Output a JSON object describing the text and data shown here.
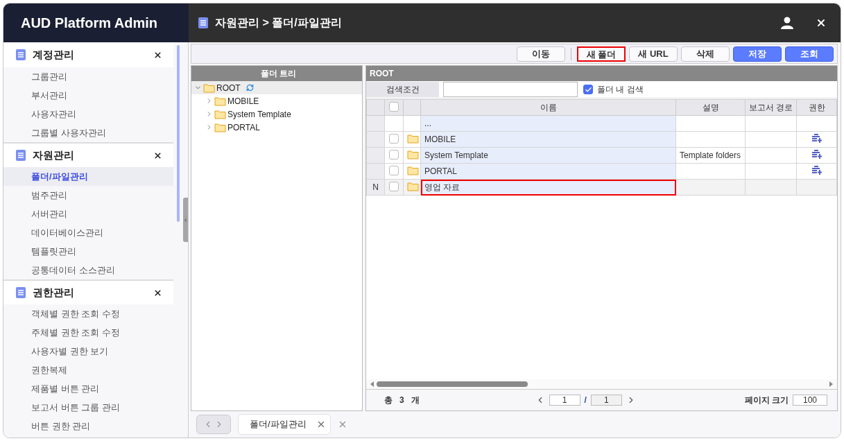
{
  "app_title": "AUD Platform Admin",
  "breadcrumb": "자원관리 > 폴더/파일관리",
  "sidebar": {
    "sections": [
      {
        "title": "계정관리",
        "items": [
          {
            "label": "그룹관리",
            "selected": false
          },
          {
            "label": "부서관리",
            "selected": false
          },
          {
            "label": "사용자관리",
            "selected": false
          },
          {
            "label": "그룹별 사용자관리",
            "selected": false
          }
        ]
      },
      {
        "title": "자원관리",
        "items": [
          {
            "label": "폴더/파일관리",
            "selected": true
          },
          {
            "label": "범주관리",
            "selected": false
          },
          {
            "label": "서버관리",
            "selected": false
          },
          {
            "label": "데이터베이스관리",
            "selected": false
          },
          {
            "label": "템플릿관리",
            "selected": false
          },
          {
            "label": "공통데이터 소스관리",
            "selected": false
          }
        ]
      },
      {
        "title": "권한관리",
        "items": [
          {
            "label": "객체별 권한 조회 수정",
            "selected": false
          },
          {
            "label": "주체별 권한 조회 수정",
            "selected": false
          },
          {
            "label": "사용자별 권한 보기",
            "selected": false
          },
          {
            "label": "권한복제",
            "selected": false
          },
          {
            "label": "제품별 버튼 관리",
            "selected": false
          },
          {
            "label": "보고서 버튼 그룹 관리",
            "selected": false
          },
          {
            "label": "버튼 권한 관리",
            "selected": false
          }
        ]
      }
    ]
  },
  "toolbar": {
    "buttons": [
      {
        "label": "이동",
        "kind": "default",
        "highlighted": false
      },
      {
        "label": "새 폴더",
        "kind": "default",
        "highlighted": true
      },
      {
        "label": "새 URL",
        "kind": "default",
        "highlighted": false
      },
      {
        "label": "삭제",
        "kind": "default",
        "highlighted": false
      },
      {
        "label": "저장",
        "kind": "primary",
        "highlighted": false
      },
      {
        "label": "조회",
        "kind": "primary",
        "highlighted": false
      }
    ]
  },
  "tree": {
    "title": "폴더 트리",
    "root": {
      "label": "ROOT",
      "expanded": true,
      "children": [
        {
          "label": "MOBILE",
          "expanded": false
        },
        {
          "label": "System Template",
          "expanded": false
        },
        {
          "label": "PORTAL",
          "expanded": false
        }
      ]
    }
  },
  "grid": {
    "title": "ROOT",
    "search_label": "검색조건",
    "in_folder_search": {
      "label": "폴더 내 검색",
      "checked": true
    },
    "select_all_checked": false,
    "columns": [
      "이름",
      "설명",
      "보고서 경로",
      "권한"
    ],
    "rows": [
      {
        "kind": "parent",
        "name": "..."
      },
      {
        "kind": "folder",
        "status": "",
        "checked": false,
        "name": "MOBILE",
        "description": "",
        "permission": true,
        "highlighted": false
      },
      {
        "kind": "folder",
        "status": "",
        "checked": false,
        "name": "System Template",
        "description": "Template folders",
        "permission": true,
        "highlighted": false
      },
      {
        "kind": "folder",
        "status": "",
        "checked": false,
        "name": "PORTAL",
        "description": "",
        "permission": true,
        "highlighted": false
      },
      {
        "kind": "folder",
        "status": "N",
        "checked": false,
        "name": "영업 자료",
        "description": "",
        "permission": false,
        "highlighted": true
      }
    ],
    "footer": {
      "total_label": "총",
      "total": "3",
      "unit": "개",
      "page": "1",
      "slash": "/",
      "pages": "1",
      "page_size_label": "페이지 크기",
      "page_size": "100"
    }
  },
  "tabs": [
    {
      "label": "폴더/파일관리",
      "selected": true
    }
  ]
}
